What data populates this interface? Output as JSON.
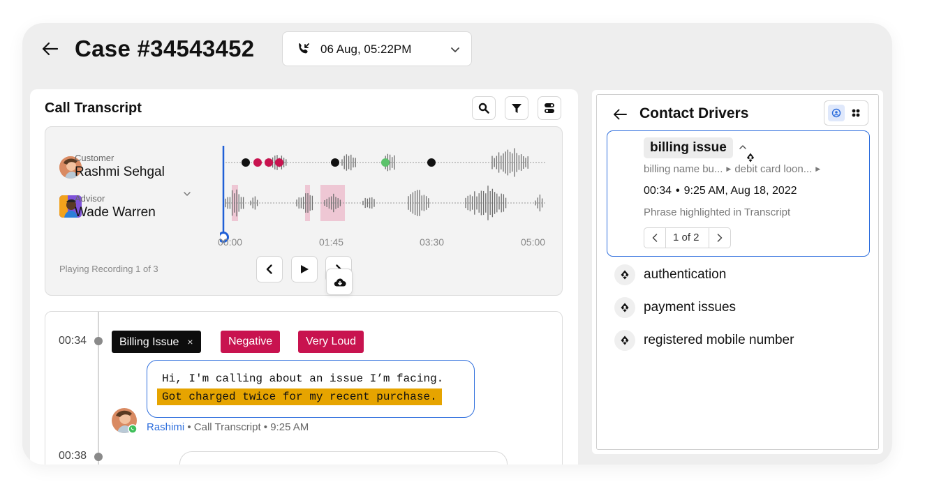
{
  "header": {
    "case_title": "Case #34543452",
    "call_selector": {
      "value": "06 Aug, 05:22PM"
    }
  },
  "transcript_panel": {
    "title": "Call Transcript",
    "toolbar": [
      "search-icon",
      "filter-icon",
      "toggle-icon"
    ],
    "player": {
      "customer_role": "Customer",
      "customer_name": "Rashmi Sehgal",
      "advisor_role": "Advisor",
      "advisor_name": "Wade Warren",
      "ticks": [
        "00:00",
        "01:45",
        "03:30",
        "05:00"
      ],
      "playing_label": "Playing Recording 1 of 3",
      "playhead_fraction": 0.0,
      "colors": {
        "playhead": "#1f5fd6",
        "negative": "#c8134f",
        "positive": "#5cc26b",
        "highlight": "#eec7d4"
      }
    },
    "entries": [
      {
        "time": "00:34",
        "tags": [
          {
            "label": "Billing Issue",
            "close": "×",
            "style": "dark"
          },
          {
            "label": "Negative",
            "style": "pink"
          },
          {
            "label": "Very Loud",
            "style": "pink"
          }
        ],
        "line1": "Hi, I'm calling about an issue I’m facing.",
        "line2_highlight": "Got charged twice for my recent purchase.",
        "speaker": "Rashimi",
        "meta": " • Call Transcript • 9:25 AM"
      },
      {
        "time": "00:38"
      }
    ]
  },
  "drivers_panel": {
    "title": "Contact Drivers",
    "selected": {
      "label": "billing issue",
      "path_1": "billing name bu...",
      "path_2": "debit card loon...",
      "time": "00:34",
      "datetime": "9:25 AM, Aug 18, 2022",
      "note": "Phrase highlighted in Transcript",
      "pager": "1 of 2"
    },
    "items": [
      "authentication",
      "payment issues",
      "registered mobile number"
    ],
    "colors": {
      "accent": "#2f6fdd"
    }
  }
}
